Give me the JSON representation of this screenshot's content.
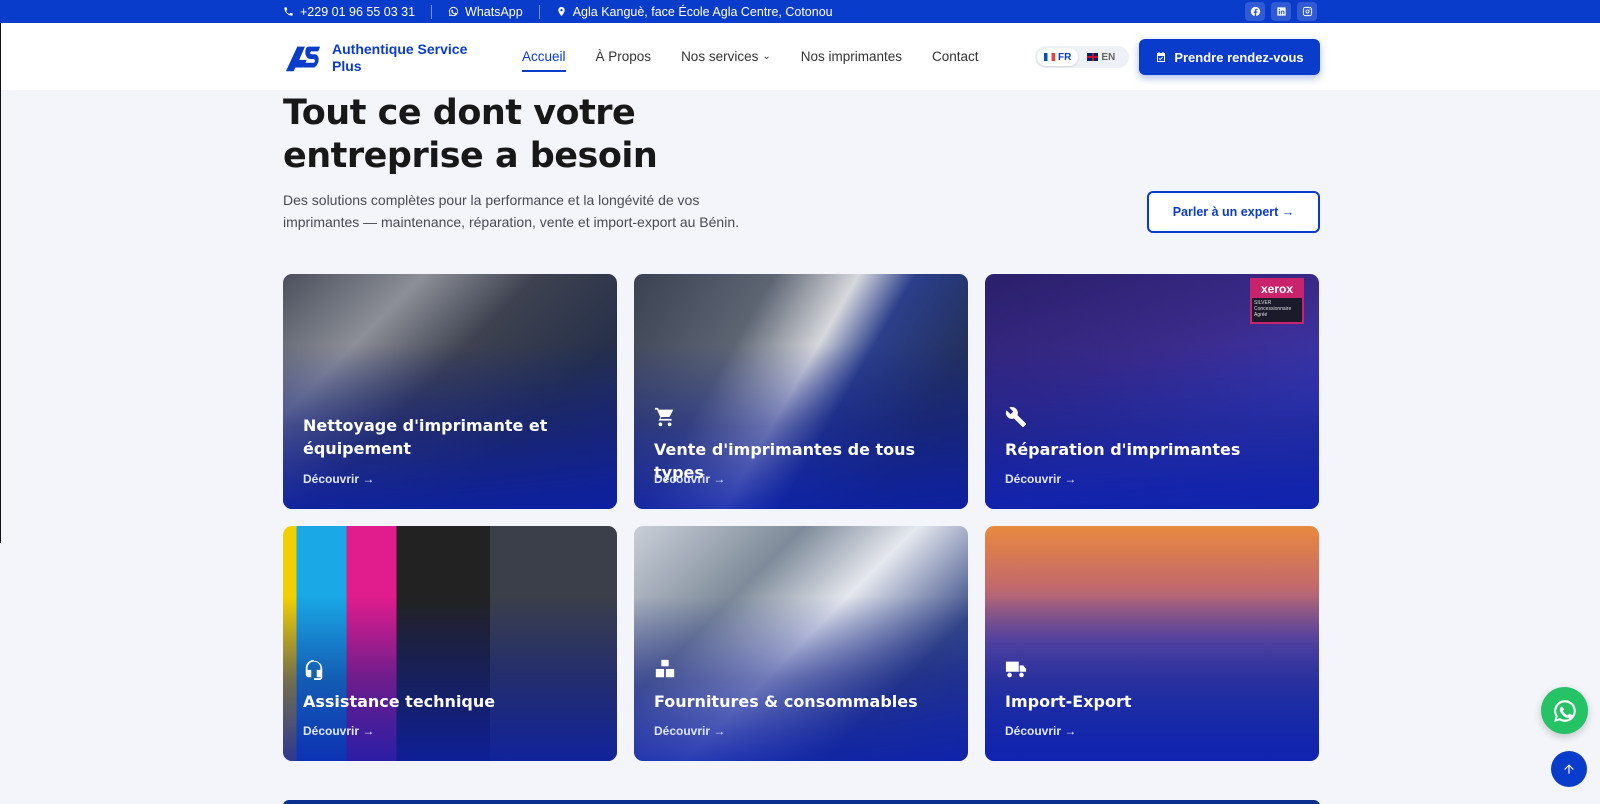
{
  "topbar": {
    "phone": "+229 01 96 55 03 31",
    "whatsapp": "WhatsApp",
    "address": "Agla Kanguè, face École Agla Centre, Cotonou",
    "social_icons": [
      "facebook-icon",
      "linkedin-icon",
      "instagram-icon"
    ]
  },
  "header": {
    "logo_text": "Authentique Service Plus",
    "nav": {
      "home": "Accueil",
      "about": "À Propos",
      "services": "Nos services",
      "printers": "Nos imprimantes",
      "contact": "Contact"
    },
    "lang": {
      "fr": "FR",
      "en": "EN",
      "active": "FR"
    },
    "cta": "Prendre rendez-vous"
  },
  "hero": {
    "title": "Tout ce dont votre entreprise a besoin",
    "subtitle": "Des solutions complètes pour la performance et la longévité de vos imprimantes — maintenance, réparation, vente et import-export au Bénin.",
    "expert_button": "Parler à un expert →"
  },
  "cards": [
    {
      "title": "Nettoyage d'imprimante et équipement",
      "link": "Découvrir →",
      "icon": "broom-icon"
    },
    {
      "title": "Vente d'imprimantes de tous types",
      "link": "Découvrir →",
      "icon": "cart-icon"
    },
    {
      "title": "Réparation d'imprimantes",
      "link": "Découvrir →",
      "icon": "tools-icon",
      "badge": {
        "brand": "xerox",
        "level": "SILVER",
        "text": "Concessionnaire Agréé"
      }
    },
    {
      "title": "Assistance technique",
      "link": "Découvrir →",
      "icon": "headset-icon"
    },
    {
      "title": "Fournitures & consommables",
      "link": "Découvrir →",
      "icon": "boxes-icon"
    },
    {
      "title": "Import-Export",
      "link": "Découvrir →",
      "icon": "truck-icon"
    }
  ],
  "colors": {
    "brand": "#0a3ccc",
    "whatsapp": "#25c366",
    "xerox": "#c8236b"
  }
}
